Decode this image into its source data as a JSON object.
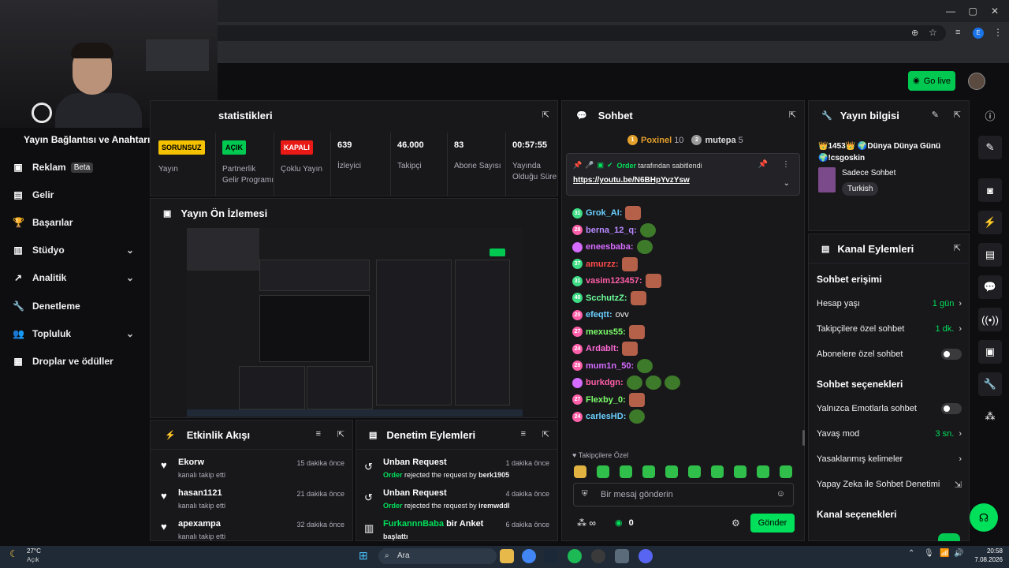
{
  "browser": {
    "url_icons": [
      "zoom-icon",
      "star-icon",
      "playlist-icon",
      "profile-e-icon",
      "menu-icon"
    ]
  },
  "appbar": {
    "go_live": "Go live"
  },
  "sidebar": {
    "section_title": "Yayın Bağlantısı ve Anahtarı",
    "items": [
      {
        "label": "Reklam",
        "badge": "Beta"
      },
      {
        "label": "Gelir"
      },
      {
        "label": "Başarılar"
      },
      {
        "label": "Stüdyo"
      },
      {
        "label": "Analitik"
      },
      {
        "label": "Denetleme"
      },
      {
        "label": "Topluluk"
      },
      {
        "label": "Droplar ve ödüller"
      }
    ]
  },
  "stats": {
    "title": "statistikleri",
    "cards": [
      {
        "pill": "SORUNSUZ",
        "label": "Yayın"
      },
      {
        "pill": "AÇIK",
        "label": "Partnerlik Gelir Programı"
      },
      {
        "pill": "KAPALI",
        "label": "Çoklu Yayın"
      },
      {
        "value": "639",
        "label": "İzleyici"
      },
      {
        "value": "46.000",
        "label": "Takipçi"
      },
      {
        "value": "83",
        "label": "Abone Sayısı"
      },
      {
        "value": "00:57:55",
        "label": "Yayında Olduğu Süre"
      }
    ]
  },
  "preview": {
    "title": "Yayın Ön İzlemesi"
  },
  "activity": {
    "title": "Etkinlik Akışı",
    "items": [
      {
        "name": "Ekorw",
        "desc": "kanalı takip etti",
        "time": "15 dakika önce"
      },
      {
        "name": "hasan1121",
        "desc": "kanalı takip etti",
        "time": "21 dakika önce"
      },
      {
        "name": "apexampa",
        "desc": "kanalı takip etti",
        "time": "32 dakika önce"
      }
    ]
  },
  "mod": {
    "title": "Denetim Eylemleri",
    "items": [
      {
        "name": "Unban Request",
        "actor": "Order",
        "mid": "rejected the request by",
        "target": "berk1905",
        "time": "1 dakika önce"
      },
      {
        "name": "Unban Request",
        "actor": "Order",
        "mid": "rejected the request by",
        "target": "iremwddl",
        "time": "4 dakika önce"
      },
      {
        "name": "FurkannnBaba",
        "suffix": "bir Anket",
        "desc": "başlattı",
        "time": "6 dakika önce"
      }
    ]
  },
  "chat": {
    "title": "Sohbet",
    "leaders": [
      {
        "name": "Poxinel",
        "score": "10"
      },
      {
        "name": "mutepa",
        "score": "5"
      }
    ],
    "pinned_by": "Order",
    "pinned_suffix": "tarafından sabitlendi",
    "pinned_link": "https://youtu.be/N6BHpYvzYsw",
    "messages": [
      {
        "badge": "31",
        "user": "Grok_AI:",
        "color": "#6ad0ff",
        "text": ""
      },
      {
        "badge": "28",
        "user": "berna_12_q:",
        "color": "#b98aff",
        "text": ""
      },
      {
        "badge": "",
        "user": "eneesbaba:",
        "color": "#d66bff",
        "text": ""
      },
      {
        "badge": "37",
        "user": "amurzz:",
        "color": "#ff4b4b",
        "text": ""
      },
      {
        "badge": "31",
        "user": "vasim123457:",
        "color": "#ff5ea8",
        "text": ""
      },
      {
        "badge": "40",
        "user": "ScchutzZ:",
        "color": "#6dff9a",
        "text": ""
      },
      {
        "badge": "20",
        "user": "efeqtt:",
        "color": "#6ad0ff",
        "text": "ovv"
      },
      {
        "badge": "27",
        "user": "mexus55:",
        "color": "#7dff6a",
        "text": ""
      },
      {
        "badge": "24",
        "user": "Ardablt:",
        "color": "#ff6ad5",
        "text": ""
      },
      {
        "badge": "28",
        "user": "mum1n_50:",
        "color": "#d66bff",
        "text": ""
      },
      {
        "badge": "",
        "user": "burkdgn:",
        "color": "#ff5ea8",
        "text": ""
      },
      {
        "badge": "27",
        "user": "Flexby_0:",
        "color": "#7dff6a",
        "text": ""
      },
      {
        "badge": "24",
        "user": "carlesHD:",
        "color": "#6ad0ff",
        "text": ""
      }
    ],
    "followers_only": "Takipçilere Özel",
    "input_placeholder": "Bir mesaj gönderin",
    "points": "0",
    "send": "Gönder"
  },
  "stream_info": {
    "title": "Yayın bilgisi",
    "stream_title": "👑1453👑 🌍Dünya Dünya Günü 🌍!csgoskin",
    "category": "Sadece Sohbet",
    "tag": "Turkish"
  },
  "channel_actions": {
    "title": "Kanal Eylemleri",
    "chat_access": "Sohbet erişimi",
    "rows1": [
      {
        "label": "Hesap yaşı",
        "value": "1 gün",
        "type": "arrow"
      },
      {
        "label": "Takipçilere özel sohbet",
        "value": "1 dk.",
        "type": "arrow"
      },
      {
        "label": "Abonelere özel sohbet",
        "value": "",
        "type": "toggle"
      }
    ],
    "chat_options": "Sohbet seçenekleri",
    "rows2": [
      {
        "label": "Yalnızca Emotlarla sohbet",
        "value": "",
        "type": "toggle"
      },
      {
        "label": "Yavaş mod",
        "value": "3 sn.",
        "type": "arrow"
      },
      {
        "label": "Yasaklanmış kelimeler",
        "value": "",
        "type": "arrow"
      },
      {
        "label": "Yapay Zeka ile Sohbet Denetimi",
        "value": "",
        "type": "external"
      }
    ],
    "channel_options": "Kanal seçenekleri"
  },
  "taskbar": {
    "weather_temp": "27°C",
    "weather_desc": "Açık",
    "search": "Ara",
    "time": "20:58",
    "date": "7.08.2026"
  },
  "colors": {
    "accent": "#00e05a",
    "bg": "#0e0e10",
    "panel": "#18181b"
  }
}
